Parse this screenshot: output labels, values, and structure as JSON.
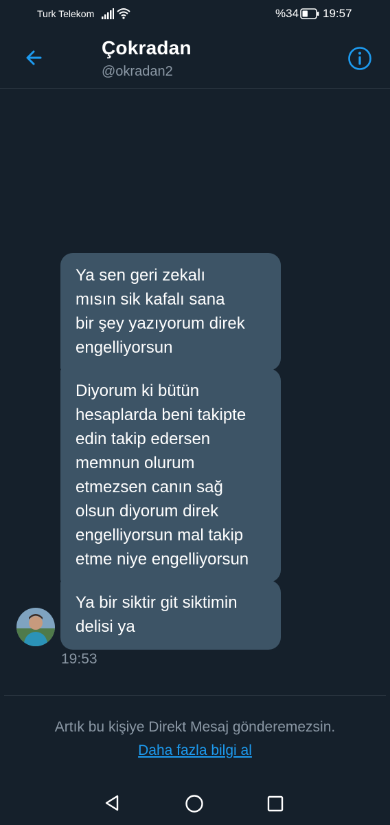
{
  "status_bar": {
    "carrier": "Turk Telekom",
    "battery_percent": "%34",
    "time": "19:57",
    "icons": [
      "signal-icon",
      "wifi-icon",
      "battery-icon"
    ]
  },
  "header": {
    "title": "Çokradan",
    "handle": "@okradan2",
    "back_icon": "back-arrow-icon",
    "info_icon": "info-icon",
    "accent_color": "#1d9bf0"
  },
  "messages": [
    {
      "lines": [
        "Ya sen geri zekalı",
        "mısın sik kafalı sana",
        "bir şey yazıyorum direk",
        "engelliyorsun"
      ]
    },
    {
      "lines": [
        "Diyorum ki bütün",
        "hesaplarda beni takipte",
        "edin takip edersen",
        "memnun olurum",
        "etmezsen canın sağ",
        "olsun diyorum direk",
        "engelliyorsun mal takip",
        "etme niye engelliyorsun"
      ]
    },
    {
      "lines": [
        "Ya bir siktir git siktimin",
        "delisi ya"
      ]
    }
  ],
  "message_time": "19:53",
  "footer": {
    "blocked_note": "Artık bu kişiye Direkt Mesaj gönderemezsin.",
    "learn_more": "Daha fazla bilgi al"
  },
  "navbar": {
    "icons": [
      "nav-back-icon",
      "nav-home-icon",
      "nav-recents-icon"
    ]
  },
  "colors": {
    "background": "#15202b",
    "bubble": "#3d5466",
    "muted_text": "#8b98a5",
    "link": "#1d9bf0"
  }
}
